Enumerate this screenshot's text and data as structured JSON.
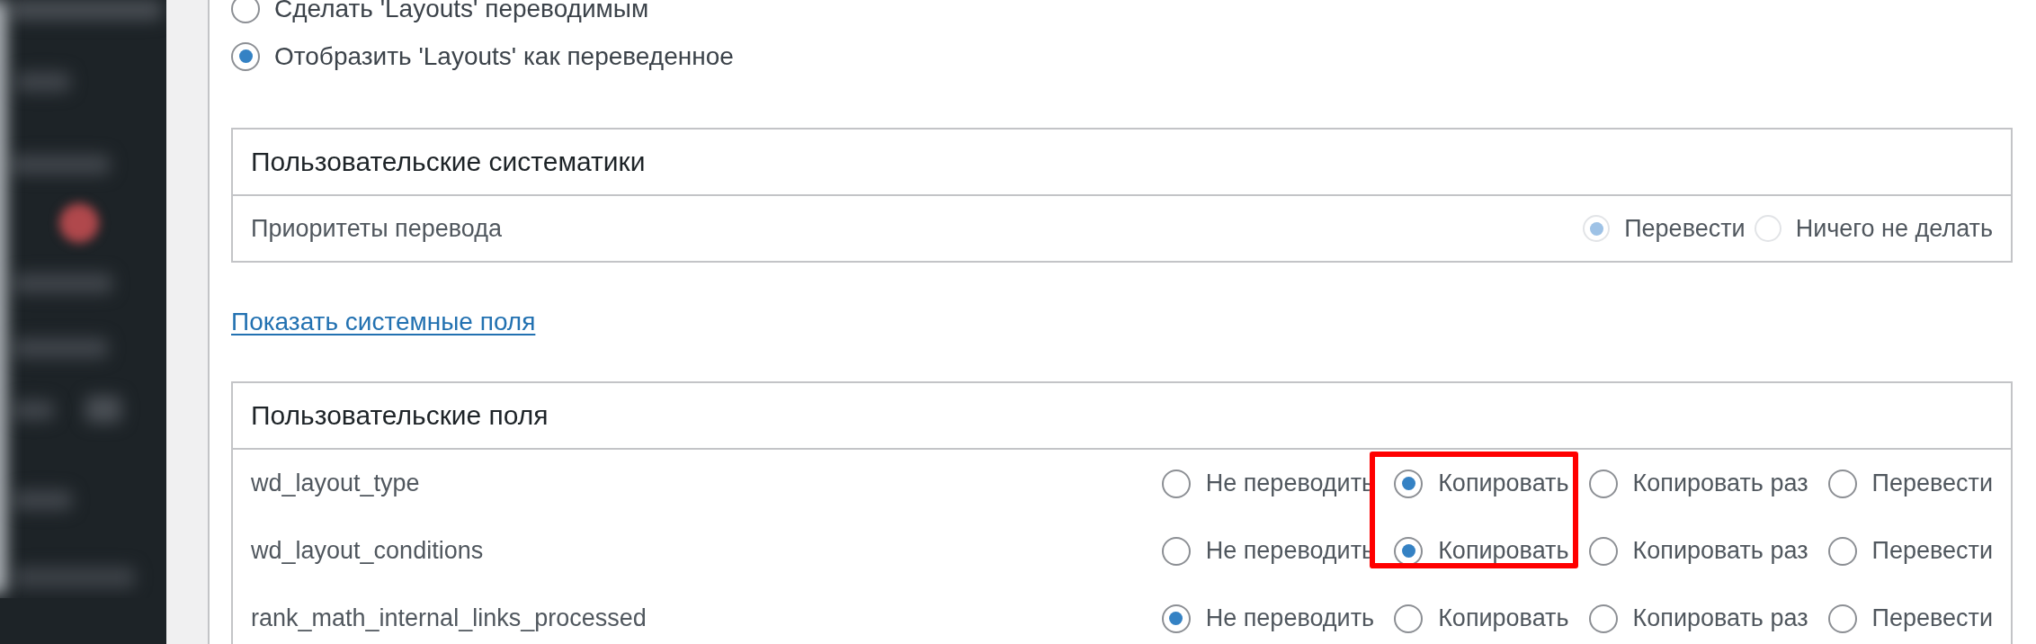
{
  "translation_mode": {
    "options": [
      {
        "label": "Сделать 'Layouts' переводимым",
        "selected": false
      },
      {
        "label": "Отобразить 'Layouts' как переведенное",
        "selected": true
      }
    ]
  },
  "custom_taxonomies": {
    "title": "Пользовательские систематики",
    "rows": [
      {
        "name": "Приоритеты перевода",
        "disabled": true,
        "options": [
          {
            "label": "Перевести",
            "selected": true
          },
          {
            "label": "Ничего не делать",
            "selected": false
          }
        ]
      }
    ]
  },
  "system_fields_link": "Показать системные поля",
  "custom_fields": {
    "title": "Пользовательские поля",
    "rows": [
      {
        "name": "wd_layout_type",
        "options": [
          {
            "label": "Не переводить",
            "selected": false
          },
          {
            "label": "Копировать",
            "selected": true
          },
          {
            "label": "Копировать раз",
            "selected": false
          },
          {
            "label": "Перевести",
            "selected": false
          }
        ]
      },
      {
        "name": "wd_layout_conditions",
        "options": [
          {
            "label": "Не переводить",
            "selected": false
          },
          {
            "label": "Копировать",
            "selected": true
          },
          {
            "label": "Копировать раз",
            "selected": false
          },
          {
            "label": "Перевести",
            "selected": false
          }
        ]
      },
      {
        "name": "rank_math_internal_links_processed",
        "options": [
          {
            "label": "Не переводить",
            "selected": true
          },
          {
            "label": "Копировать",
            "selected": false
          },
          {
            "label": "Копировать раз",
            "selected": false
          },
          {
            "label": "Перевести",
            "selected": false
          }
        ]
      }
    ]
  },
  "annotation": {
    "kind": "rectangle"
  }
}
